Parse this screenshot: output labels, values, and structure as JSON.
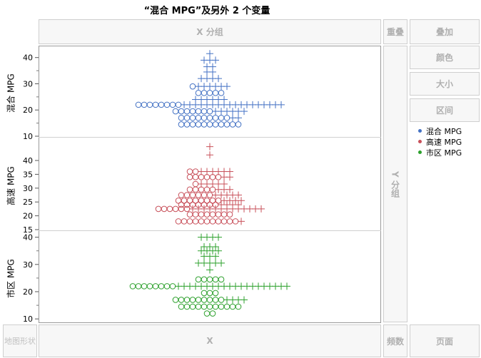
{
  "title": "“混合 MPG”及另外 2 个变量",
  "zones": {
    "x_group": "X 分组",
    "wrap": "重叠",
    "overlay": "叠加",
    "color": "颜色",
    "size": "大小",
    "interval": "区间",
    "y_group": "Y 分组",
    "map_shape": "地图形状",
    "x": "X",
    "freq": "频数",
    "page": "页面"
  },
  "legend": [
    {
      "label": "混合 MPG",
      "color": "#4472c4"
    },
    {
      "label": "高速 MPG",
      "color": "#c8505a"
    },
    {
      "label": "市区 MPG",
      "color": "#2ca02c"
    }
  ],
  "chart_data": [
    {
      "type": "scatter",
      "ylabel": "混合 MPG",
      "color": "#4472c4",
      "ylim": [
        10,
        44
      ],
      "yticks": [
        10,
        20,
        30,
        40
      ],
      "y_minor_ticks": [
        15,
        25,
        35
      ],
      "rows": [
        {
          "y": 41.5,
          "plus": 1,
          "circle": 0
        },
        {
          "y": 39,
          "plus": 3,
          "circle": 0
        },
        {
          "y": 36.5,
          "plus": 2,
          "circle": 0
        },
        {
          "y": 34.5,
          "plus": 2,
          "circle": 0
        },
        {
          "y": 32,
          "plus": 4,
          "circle": 0
        },
        {
          "y": 29,
          "plus": 6,
          "circle": 1
        },
        {
          "y": 26.5,
          "plus": 0,
          "circle": 5
        },
        {
          "y": 24,
          "plus": 6,
          "circle": 0
        },
        {
          "y": 22,
          "plus": 18,
          "circle": 8
        },
        {
          "y": 19.5,
          "plus": 6,
          "circle": 7
        },
        {
          "y": 17,
          "plus": 2,
          "circle": 9
        },
        {
          "y": 14.5,
          "plus": 0,
          "circle": 11
        }
      ]
    },
    {
      "type": "scatter",
      "ylabel": "高速 MPG",
      "color": "#c8505a",
      "ylim": [
        15,
        48
      ],
      "yticks": [
        15,
        20,
        25,
        30,
        35,
        40
      ],
      "y_minor_ticks": [],
      "rows": [
        {
          "y": 45,
          "plus": 1,
          "circle": 0
        },
        {
          "y": 42,
          "plus": 1,
          "circle": 0
        },
        {
          "y": 36,
          "plus": 6,
          "circle": 2
        },
        {
          "y": 34,
          "plus": 2,
          "circle": 6
        },
        {
          "y": 31.5,
          "plus": 5,
          "circle": 1
        },
        {
          "y": 29.5,
          "plus": 3,
          "circle": 5
        },
        {
          "y": 27.5,
          "plus": 5,
          "circle": 6
        },
        {
          "y": 25.5,
          "plus": 4,
          "circle": 8
        },
        {
          "y": 24,
          "plus": 4,
          "circle": 7
        },
        {
          "y": 22.5,
          "plus": 13,
          "circle": 6
        },
        {
          "y": 20.5,
          "plus": 0,
          "circle": 8
        },
        {
          "y": 18,
          "plus": 1,
          "circle": 11
        }
      ]
    },
    {
      "type": "scatter",
      "ylabel": "市区 MPG",
      "color": "#2ca02c",
      "ylim": [
        9,
        42
      ],
      "yticks": [
        10,
        20,
        30,
        40
      ],
      "y_minor_ticks": [
        15,
        25,
        35
      ],
      "rows": [
        {
          "y": 40,
          "plus": 4,
          "circle": 0
        },
        {
          "y": 36.5,
          "plus": 3,
          "circle": 0
        },
        {
          "y": 35,
          "plus": 4,
          "circle": 0
        },
        {
          "y": 33,
          "plus": 3,
          "circle": 0
        },
        {
          "y": 30.5,
          "plus": 5,
          "circle": 0
        },
        {
          "y": 28,
          "plus": 1,
          "circle": 0
        },
        {
          "y": 24.5,
          "plus": 0,
          "circle": 5
        },
        {
          "y": 22,
          "plus": 20,
          "circle": 8
        },
        {
          "y": 19.5,
          "plus": 0,
          "circle": 3
        },
        {
          "y": 17,
          "plus": 4,
          "circle": 9
        },
        {
          "y": 14.5,
          "plus": 0,
          "circle": 11
        },
        {
          "y": 12,
          "plus": 0,
          "circle": 2
        }
      ]
    }
  ]
}
